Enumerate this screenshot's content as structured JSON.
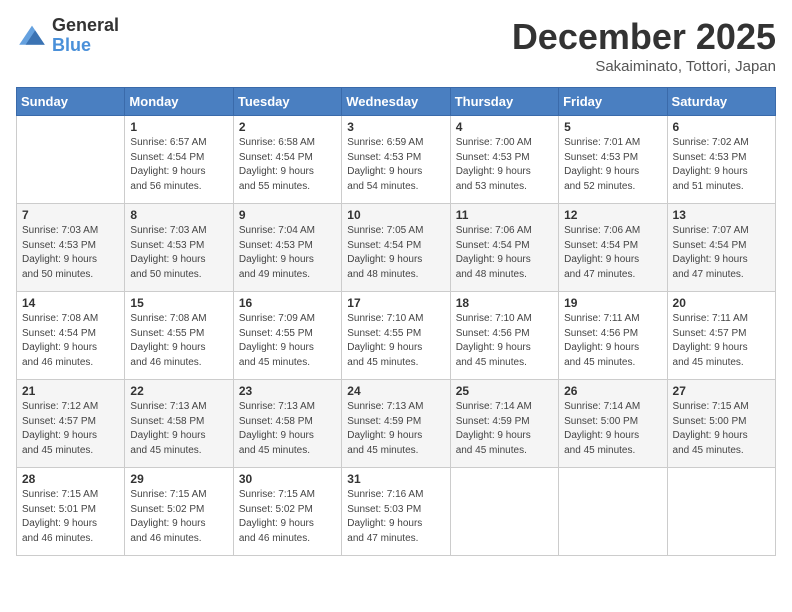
{
  "logo": {
    "general": "General",
    "blue": "Blue"
  },
  "header": {
    "title": "December 2025",
    "location": "Sakaiminato, Tottori, Japan"
  },
  "weekdays": [
    "Sunday",
    "Monday",
    "Tuesday",
    "Wednesday",
    "Thursday",
    "Friday",
    "Saturday"
  ],
  "weeks": [
    [
      {
        "day": "",
        "info": ""
      },
      {
        "day": "1",
        "info": "Sunrise: 6:57 AM\nSunset: 4:54 PM\nDaylight: 9 hours\nand 56 minutes."
      },
      {
        "day": "2",
        "info": "Sunrise: 6:58 AM\nSunset: 4:54 PM\nDaylight: 9 hours\nand 55 minutes."
      },
      {
        "day": "3",
        "info": "Sunrise: 6:59 AM\nSunset: 4:53 PM\nDaylight: 9 hours\nand 54 minutes."
      },
      {
        "day": "4",
        "info": "Sunrise: 7:00 AM\nSunset: 4:53 PM\nDaylight: 9 hours\nand 53 minutes."
      },
      {
        "day": "5",
        "info": "Sunrise: 7:01 AM\nSunset: 4:53 PM\nDaylight: 9 hours\nand 52 minutes."
      },
      {
        "day": "6",
        "info": "Sunrise: 7:02 AM\nSunset: 4:53 PM\nDaylight: 9 hours\nand 51 minutes."
      }
    ],
    [
      {
        "day": "7",
        "info": "Sunrise: 7:03 AM\nSunset: 4:53 PM\nDaylight: 9 hours\nand 50 minutes."
      },
      {
        "day": "8",
        "info": "Sunrise: 7:03 AM\nSunset: 4:53 PM\nDaylight: 9 hours\nand 50 minutes."
      },
      {
        "day": "9",
        "info": "Sunrise: 7:04 AM\nSunset: 4:53 PM\nDaylight: 9 hours\nand 49 minutes."
      },
      {
        "day": "10",
        "info": "Sunrise: 7:05 AM\nSunset: 4:54 PM\nDaylight: 9 hours\nand 48 minutes."
      },
      {
        "day": "11",
        "info": "Sunrise: 7:06 AM\nSunset: 4:54 PM\nDaylight: 9 hours\nand 48 minutes."
      },
      {
        "day": "12",
        "info": "Sunrise: 7:06 AM\nSunset: 4:54 PM\nDaylight: 9 hours\nand 47 minutes."
      },
      {
        "day": "13",
        "info": "Sunrise: 7:07 AM\nSunset: 4:54 PM\nDaylight: 9 hours\nand 47 minutes."
      }
    ],
    [
      {
        "day": "14",
        "info": "Sunrise: 7:08 AM\nSunset: 4:54 PM\nDaylight: 9 hours\nand 46 minutes."
      },
      {
        "day": "15",
        "info": "Sunrise: 7:08 AM\nSunset: 4:55 PM\nDaylight: 9 hours\nand 46 minutes."
      },
      {
        "day": "16",
        "info": "Sunrise: 7:09 AM\nSunset: 4:55 PM\nDaylight: 9 hours\nand 45 minutes."
      },
      {
        "day": "17",
        "info": "Sunrise: 7:10 AM\nSunset: 4:55 PM\nDaylight: 9 hours\nand 45 minutes."
      },
      {
        "day": "18",
        "info": "Sunrise: 7:10 AM\nSunset: 4:56 PM\nDaylight: 9 hours\nand 45 minutes."
      },
      {
        "day": "19",
        "info": "Sunrise: 7:11 AM\nSunset: 4:56 PM\nDaylight: 9 hours\nand 45 minutes."
      },
      {
        "day": "20",
        "info": "Sunrise: 7:11 AM\nSunset: 4:57 PM\nDaylight: 9 hours\nand 45 minutes."
      }
    ],
    [
      {
        "day": "21",
        "info": "Sunrise: 7:12 AM\nSunset: 4:57 PM\nDaylight: 9 hours\nand 45 minutes."
      },
      {
        "day": "22",
        "info": "Sunrise: 7:13 AM\nSunset: 4:58 PM\nDaylight: 9 hours\nand 45 minutes."
      },
      {
        "day": "23",
        "info": "Sunrise: 7:13 AM\nSunset: 4:58 PM\nDaylight: 9 hours\nand 45 minutes."
      },
      {
        "day": "24",
        "info": "Sunrise: 7:13 AM\nSunset: 4:59 PM\nDaylight: 9 hours\nand 45 minutes."
      },
      {
        "day": "25",
        "info": "Sunrise: 7:14 AM\nSunset: 4:59 PM\nDaylight: 9 hours\nand 45 minutes."
      },
      {
        "day": "26",
        "info": "Sunrise: 7:14 AM\nSunset: 5:00 PM\nDaylight: 9 hours\nand 45 minutes."
      },
      {
        "day": "27",
        "info": "Sunrise: 7:15 AM\nSunset: 5:00 PM\nDaylight: 9 hours\nand 45 minutes."
      }
    ],
    [
      {
        "day": "28",
        "info": "Sunrise: 7:15 AM\nSunset: 5:01 PM\nDaylight: 9 hours\nand 46 minutes."
      },
      {
        "day": "29",
        "info": "Sunrise: 7:15 AM\nSunset: 5:02 PM\nDaylight: 9 hours\nand 46 minutes."
      },
      {
        "day": "30",
        "info": "Sunrise: 7:15 AM\nSunset: 5:02 PM\nDaylight: 9 hours\nand 46 minutes."
      },
      {
        "day": "31",
        "info": "Sunrise: 7:16 AM\nSunset: 5:03 PM\nDaylight: 9 hours\nand 47 minutes."
      },
      {
        "day": "",
        "info": ""
      },
      {
        "day": "",
        "info": ""
      },
      {
        "day": "",
        "info": ""
      }
    ]
  ]
}
